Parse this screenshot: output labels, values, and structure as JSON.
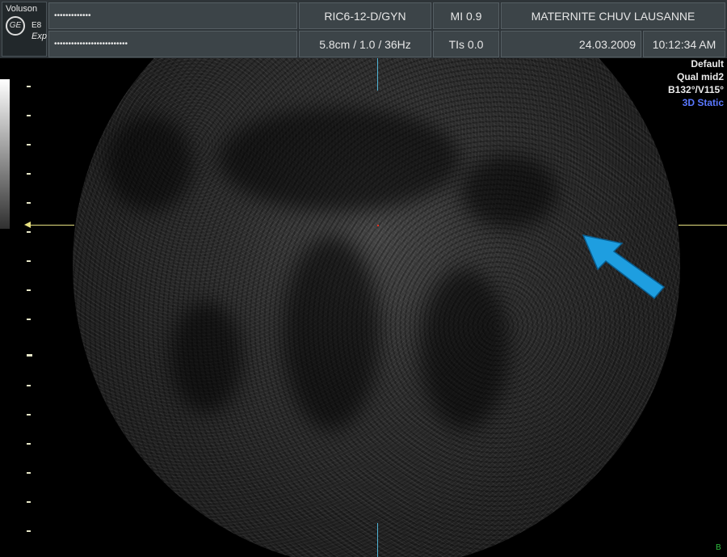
{
  "header": {
    "brand": "Voluson",
    "model": "E8",
    "mode": "Exp",
    "ge_logo_text": "GE",
    "patient_name_mask": "•••••••••••••",
    "patient_id_mask": "••••••••••••••••••••••••••",
    "probe": "RIC6-12-D/GYN",
    "depth_settings": "5.8cm / 1.0 / 36Hz",
    "mi": "MI  0.9",
    "tis": "TIs  0.0",
    "institution": "MATERNITE CHUV LAUSANNE",
    "date": "24.03.2009",
    "time": "10:12:34 AM"
  },
  "info_panel": {
    "preset": "Default",
    "quality": "Qual mid2",
    "angles": "B132°/V115°",
    "mode_3d": "3D Static"
  },
  "corner_marker": "B",
  "colors": {
    "header_bg": "#2e3438",
    "cell_bg": "#3c4448",
    "annotation_arrow": "#1e9ee0",
    "crosshair_vertical": "#4fb4d6",
    "crosshair_horizontal": "#e6e080",
    "mode_3d_text": "#5a78ff"
  },
  "icons": {
    "logo": "ge-logo-icon",
    "annotation": "arrow-annotation-icon"
  }
}
